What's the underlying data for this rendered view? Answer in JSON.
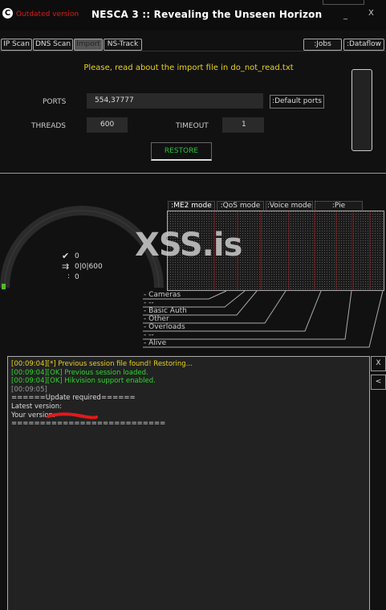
{
  "window": {
    "status": "Outdated version",
    "title": "NESCA 3 :: Revealing the Unseen Horizon",
    "minimize": "_",
    "close": "X"
  },
  "tabs": [
    {
      "label": "IP Scan"
    },
    {
      "label": "DNS Scan"
    },
    {
      "label": "Import",
      "active": true
    },
    {
      "label": "NS-Track"
    },
    {
      "label": ":Jobs"
    },
    {
      "label": ":Dataflow"
    }
  ],
  "import": {
    "note": "Please, read about the import file in do_not_read.txt",
    "ports_label": "PORTS",
    "ports_value": "554,37777",
    "default_ports": ":Default ports",
    "threads_label": "THREADS",
    "threads_value": "600",
    "timeout_label": "TIMEOUT",
    "timeout_value": "1",
    "restore": "RESTORE"
  },
  "stats": {
    "check_count": "0",
    "threads_ratio": "0|0|600",
    "other_count": "0",
    "check_symbol": "✔",
    "threads_symbol": "⇉",
    "other_symbol": ":"
  },
  "mode_tabs": [
    {
      "label": ":ME2 mode",
      "active": true
    },
    {
      "label": ":QoS mode"
    },
    {
      "label": ":Voice mode"
    },
    {
      "label": ":Pie statistics"
    }
  ],
  "legend": [
    "- Cameras",
    "- --",
    "- Basic Auth",
    "- Other",
    "- Overloads",
    "- --",
    "- Alive"
  ],
  "watermark": "XSS.is",
  "log": [
    {
      "text": "[00:09:04][*] Previous session file found! Restoring...",
      "color": "#e8d21d"
    },
    {
      "text": "[00:09:04][OK] Previous session loaded.",
      "color": "#2ed62e"
    },
    {
      "text": "[00:09:04][OK] Hikvision support enabled.",
      "color": "#2ed62e"
    },
    {
      "text": "[00:09:05]",
      "color": "#999999"
    },
    {
      "text": "======Update required======",
      "color": "#dddddd"
    },
    {
      "text": "Latest version:",
      "color": "#dddddd"
    },
    {
      "text": "Your version:",
      "color": "#dddddd"
    },
    {
      "text": "===========================",
      "color": "#dddddd"
    }
  ],
  "log_buttons": [
    "X",
    "<"
  ],
  "colors": {
    "accent_yellow": "#e8d21d",
    "status_red": "#e01919",
    "ok_green": "#2ed62e",
    "restore_green": "#25c43a",
    "redaction": "#e01a1a"
  }
}
